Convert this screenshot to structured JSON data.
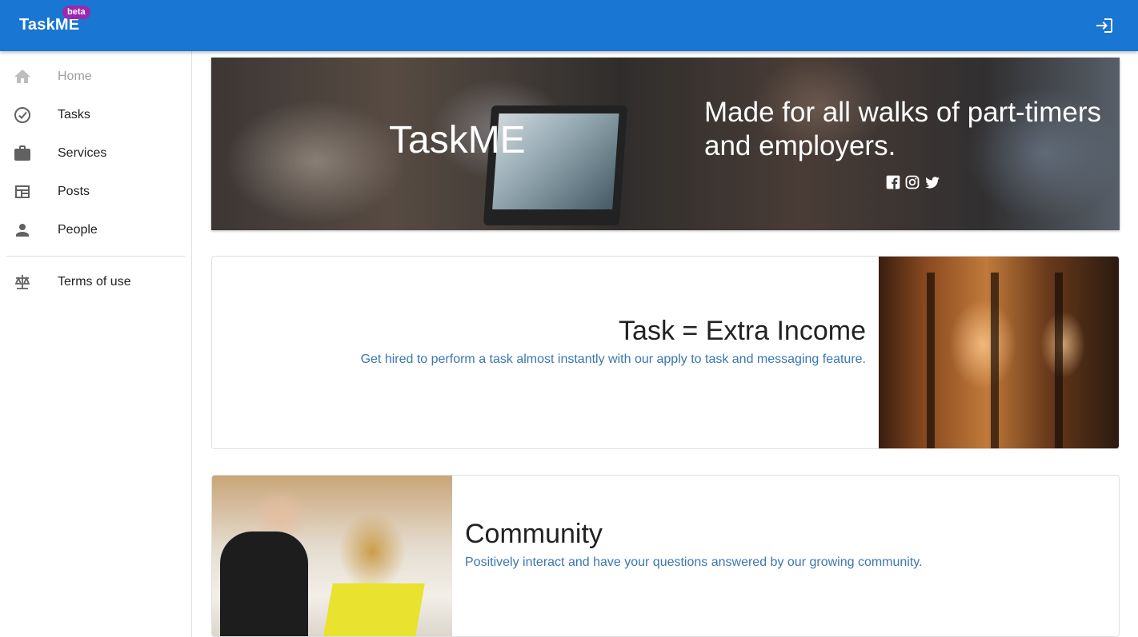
{
  "appbar": {
    "brand": "TaskME",
    "badge": "beta",
    "login_icon": "login-icon"
  },
  "sidebar": {
    "items": [
      {
        "label": "Home",
        "icon": "home-icon",
        "state": "disabled"
      },
      {
        "label": "Tasks",
        "icon": "check-circle-icon"
      },
      {
        "label": "Services",
        "icon": "briefcase-icon"
      },
      {
        "label": "Posts",
        "icon": "posts-icon"
      },
      {
        "label": "People",
        "icon": "person-icon"
      }
    ],
    "secondary_items": [
      {
        "label": "Terms of use",
        "icon": "scale-icon"
      }
    ]
  },
  "hero": {
    "title": "TaskME",
    "tagline": "Made for all walks of part-timers and employers.",
    "socials": [
      "facebook-icon",
      "instagram-icon",
      "twitter-icon"
    ]
  },
  "cards": [
    {
      "title": "Task = Extra Income",
      "subtitle": "Get hired to perform a task almost instantly with our apply to task and messaging feature."
    },
    {
      "title": "Community",
      "subtitle": "Positively interact and have your questions answered by our growing community."
    }
  ],
  "colors": {
    "appbar": "#1976d2",
    "badge": "#9c27b0",
    "subtitle_text": "#3a76b0"
  }
}
